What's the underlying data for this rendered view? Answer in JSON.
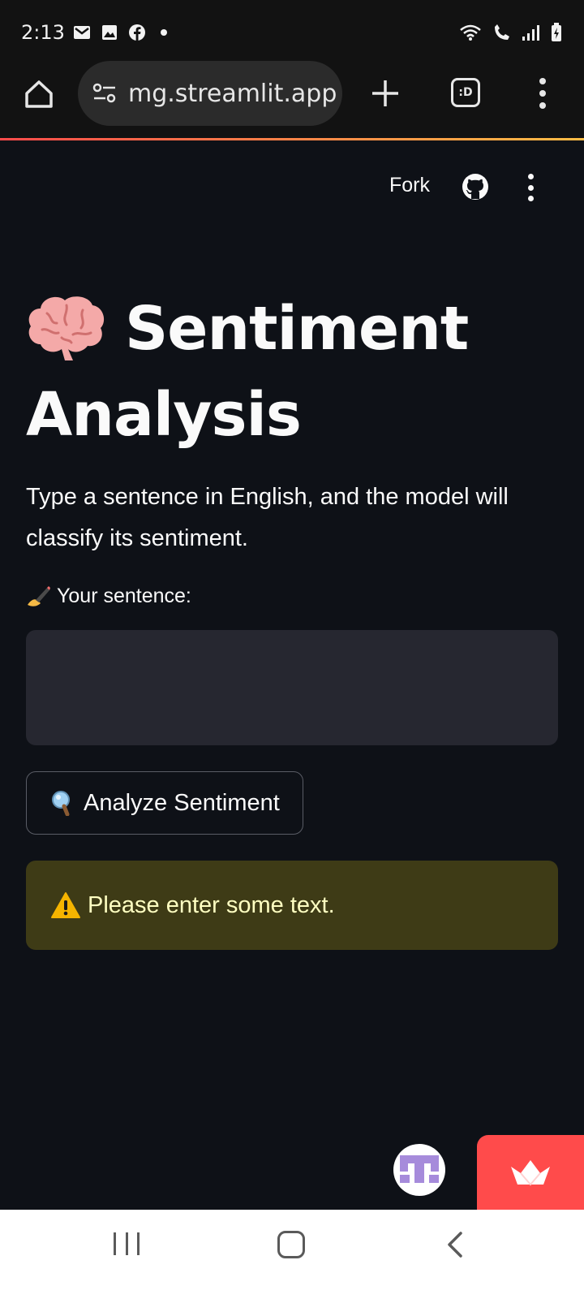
{
  "status_bar": {
    "time": "2:13",
    "left_icons": [
      "gmail-icon",
      "gallery-icon",
      "facebook-icon",
      "notification-dot"
    ],
    "right_icons": [
      "wifi-icon",
      "call-icon",
      "signal-icon",
      "battery-icon"
    ]
  },
  "browser": {
    "url": "mg.streamlit.app",
    "tab_label": ":D"
  },
  "header": {
    "fork_label": "Fork"
  },
  "main": {
    "title": "Sentiment Analysis",
    "description": "Type a sentence in English, and the model will classify its sentiment.",
    "input_label": "Your sentence:",
    "input_value": "",
    "button_label": "Analyze Sentiment",
    "warning_text": "Please enter some text."
  },
  "colors": {
    "background": "#0e1117",
    "input_bg": "#262730",
    "warning_bg": "#3e3b16",
    "warning_text": "#ffffc2",
    "accent": "#ff4b4b"
  }
}
